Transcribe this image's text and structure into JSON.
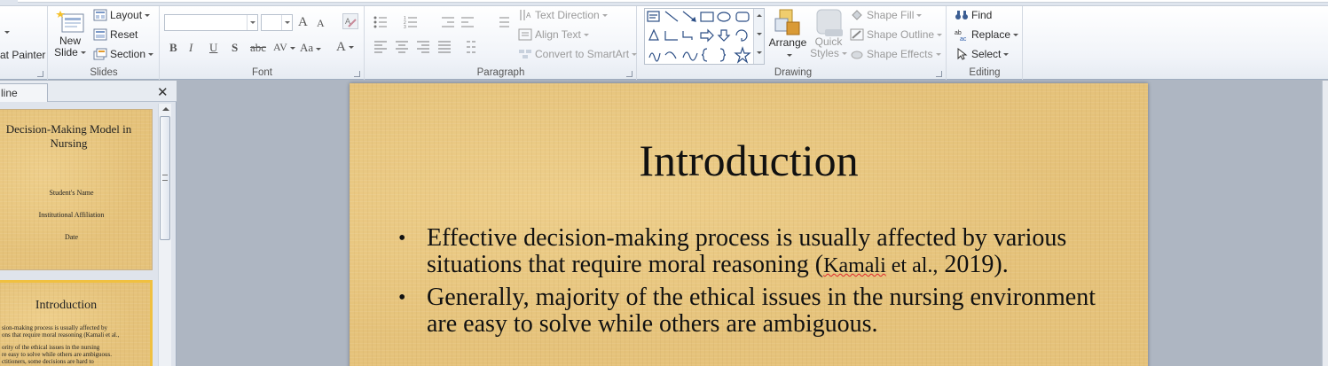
{
  "ribbon": {
    "clipboard": {
      "format_painter": "at Painter"
    },
    "slides": {
      "label": "Slides",
      "new_slide_1": "New",
      "new_slide_2": "Slide",
      "layout": "Layout",
      "reset": "Reset",
      "section": "Section"
    },
    "font": {
      "label": "Font",
      "font_name": "",
      "font_size": "",
      "grow": "A",
      "shrink": "A",
      "bold": "B",
      "italic": "I",
      "underline": "U",
      "shadow": "S",
      "strike": "abc",
      "spacing": "AV",
      "case": "Aa",
      "color": "A"
    },
    "paragraph": {
      "label": "Paragraph",
      "text_direction": "Text Direction",
      "align_text": "Align Text",
      "smartart": "Convert to SmartArt"
    },
    "drawing": {
      "label": "Drawing",
      "arrange": "Arrange",
      "quick_styles_1": "Quick",
      "quick_styles_2": "Styles",
      "shape_fill": "Shape Fill",
      "shape_outline": "Shape Outline",
      "shape_effects": "Shape Effects"
    },
    "editing": {
      "label": "Editing",
      "find": "Find",
      "replace": "Replace",
      "select": "Select"
    }
  },
  "left_pane": {
    "tab_label": "line",
    "thumb1": {
      "title": "Decision-Making Model in Nursing",
      "name": "Student's Name",
      "affiliation": "Institutional Affiliation",
      "date": "Date"
    },
    "thumb2": {
      "title": "Introduction",
      "line1": "sion-making process is usually affected by",
      "line2": "ons that require moral reasoning (Kamali et al.,",
      "line3": "ority of the ethical issues in the nursing",
      "line4": "re easy to solve while others are ambiguous.",
      "line5": "ctitioners, some decisions are hard to"
    }
  },
  "slide": {
    "title": "Introduction",
    "bullet1_a": "Effective decision-making process is usually affected by various situations that require moral reasoning (",
    "bullet1_cite_name": "Kamali",
    "bullet1_cite_rest": " et al.,",
    "bullet1_b": "2019).",
    "bullet2": "Generally, majority of the ethical issues in the nursing environment are easy to solve while others are ambiguous."
  },
  "colors": {
    "ribbon_bg": "#f1f4f9",
    "slide_paper": "#e5c27a",
    "selected_border": "#f0c040",
    "spell_error": "#e0262b"
  }
}
